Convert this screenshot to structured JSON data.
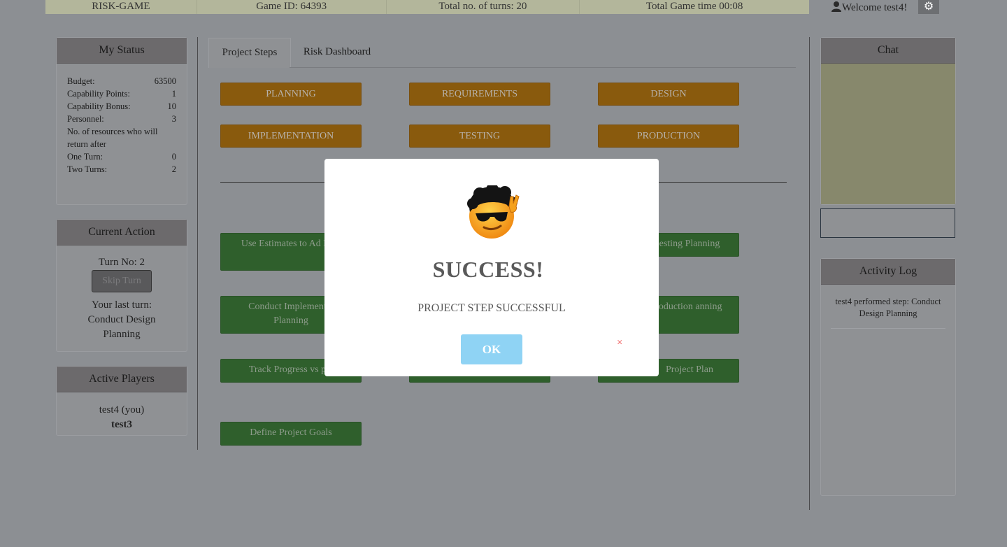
{
  "topbar": {
    "title": "RISK-GAME",
    "game_id": "Game  ID: 64393",
    "turns": "Total  no. of turns:  20",
    "time": "Total  Game  time 00:08",
    "welcome": "Welcome    test4!"
  },
  "status": {
    "header": "My Status",
    "rows": [
      {
        "label": "Budget:",
        "value": "63500"
      },
      {
        "label": "Capability  Points:",
        "value": "1"
      },
      {
        "label": "Capability  Bonus:",
        "value": "10"
      },
      {
        "label": "Personnel:",
        "value": "3"
      }
    ],
    "resources_note": "No. of resources  who  will return  after",
    "rows2": [
      {
        "label": "One Turn:",
        "value": "0"
      },
      {
        "label": "Two Turns:",
        "value": "2"
      }
    ]
  },
  "action": {
    "header": "Current   Action",
    "turn_no": "Turn  No: 2",
    "skip": "Skip Turn",
    "last_turn_label": "Your  last turn:",
    "last_turn_value": "Conduct  Design Planning"
  },
  "players": {
    "header": "Active  Players",
    "list": [
      "test4  (you)",
      "test3"
    ]
  },
  "tabs": [
    "Project Steps",
    "Risk Dashboard"
  ],
  "phases": [
    "PLANNING",
    "REQUIREMENTS",
    "DESIGN",
    "IMPLEMENTATION",
    "TESTING",
    "PRODUCTION"
  ],
  "steps": {
    "use_estimates": "Use Estimates  to Ad Plan",
    "testing_planning": "esting  Planning",
    "conduct_impl": "Conduct  Implementat Planning",
    "production": "Production anning",
    "track_progress": "Track Progress  vs p",
    "project_plan": "Project Plan",
    "define_goals": "Define  Project Goals"
  },
  "chat": {
    "header": "Chat"
  },
  "activity": {
    "header": "Activity  Log",
    "entries": [
      "test4  performed   step:  Conduct Design  Planning"
    ]
  },
  "modal": {
    "title": "SUCCESS!",
    "message": "PROJECT STEP SUCCESSFUL",
    "ok": "OK",
    "close": "×"
  },
  "colors": {
    "phase_button": "#895a0d",
    "step_button": "#2f5f2c",
    "ok_button": "#8fd3f4",
    "close_x": "#f27474"
  }
}
